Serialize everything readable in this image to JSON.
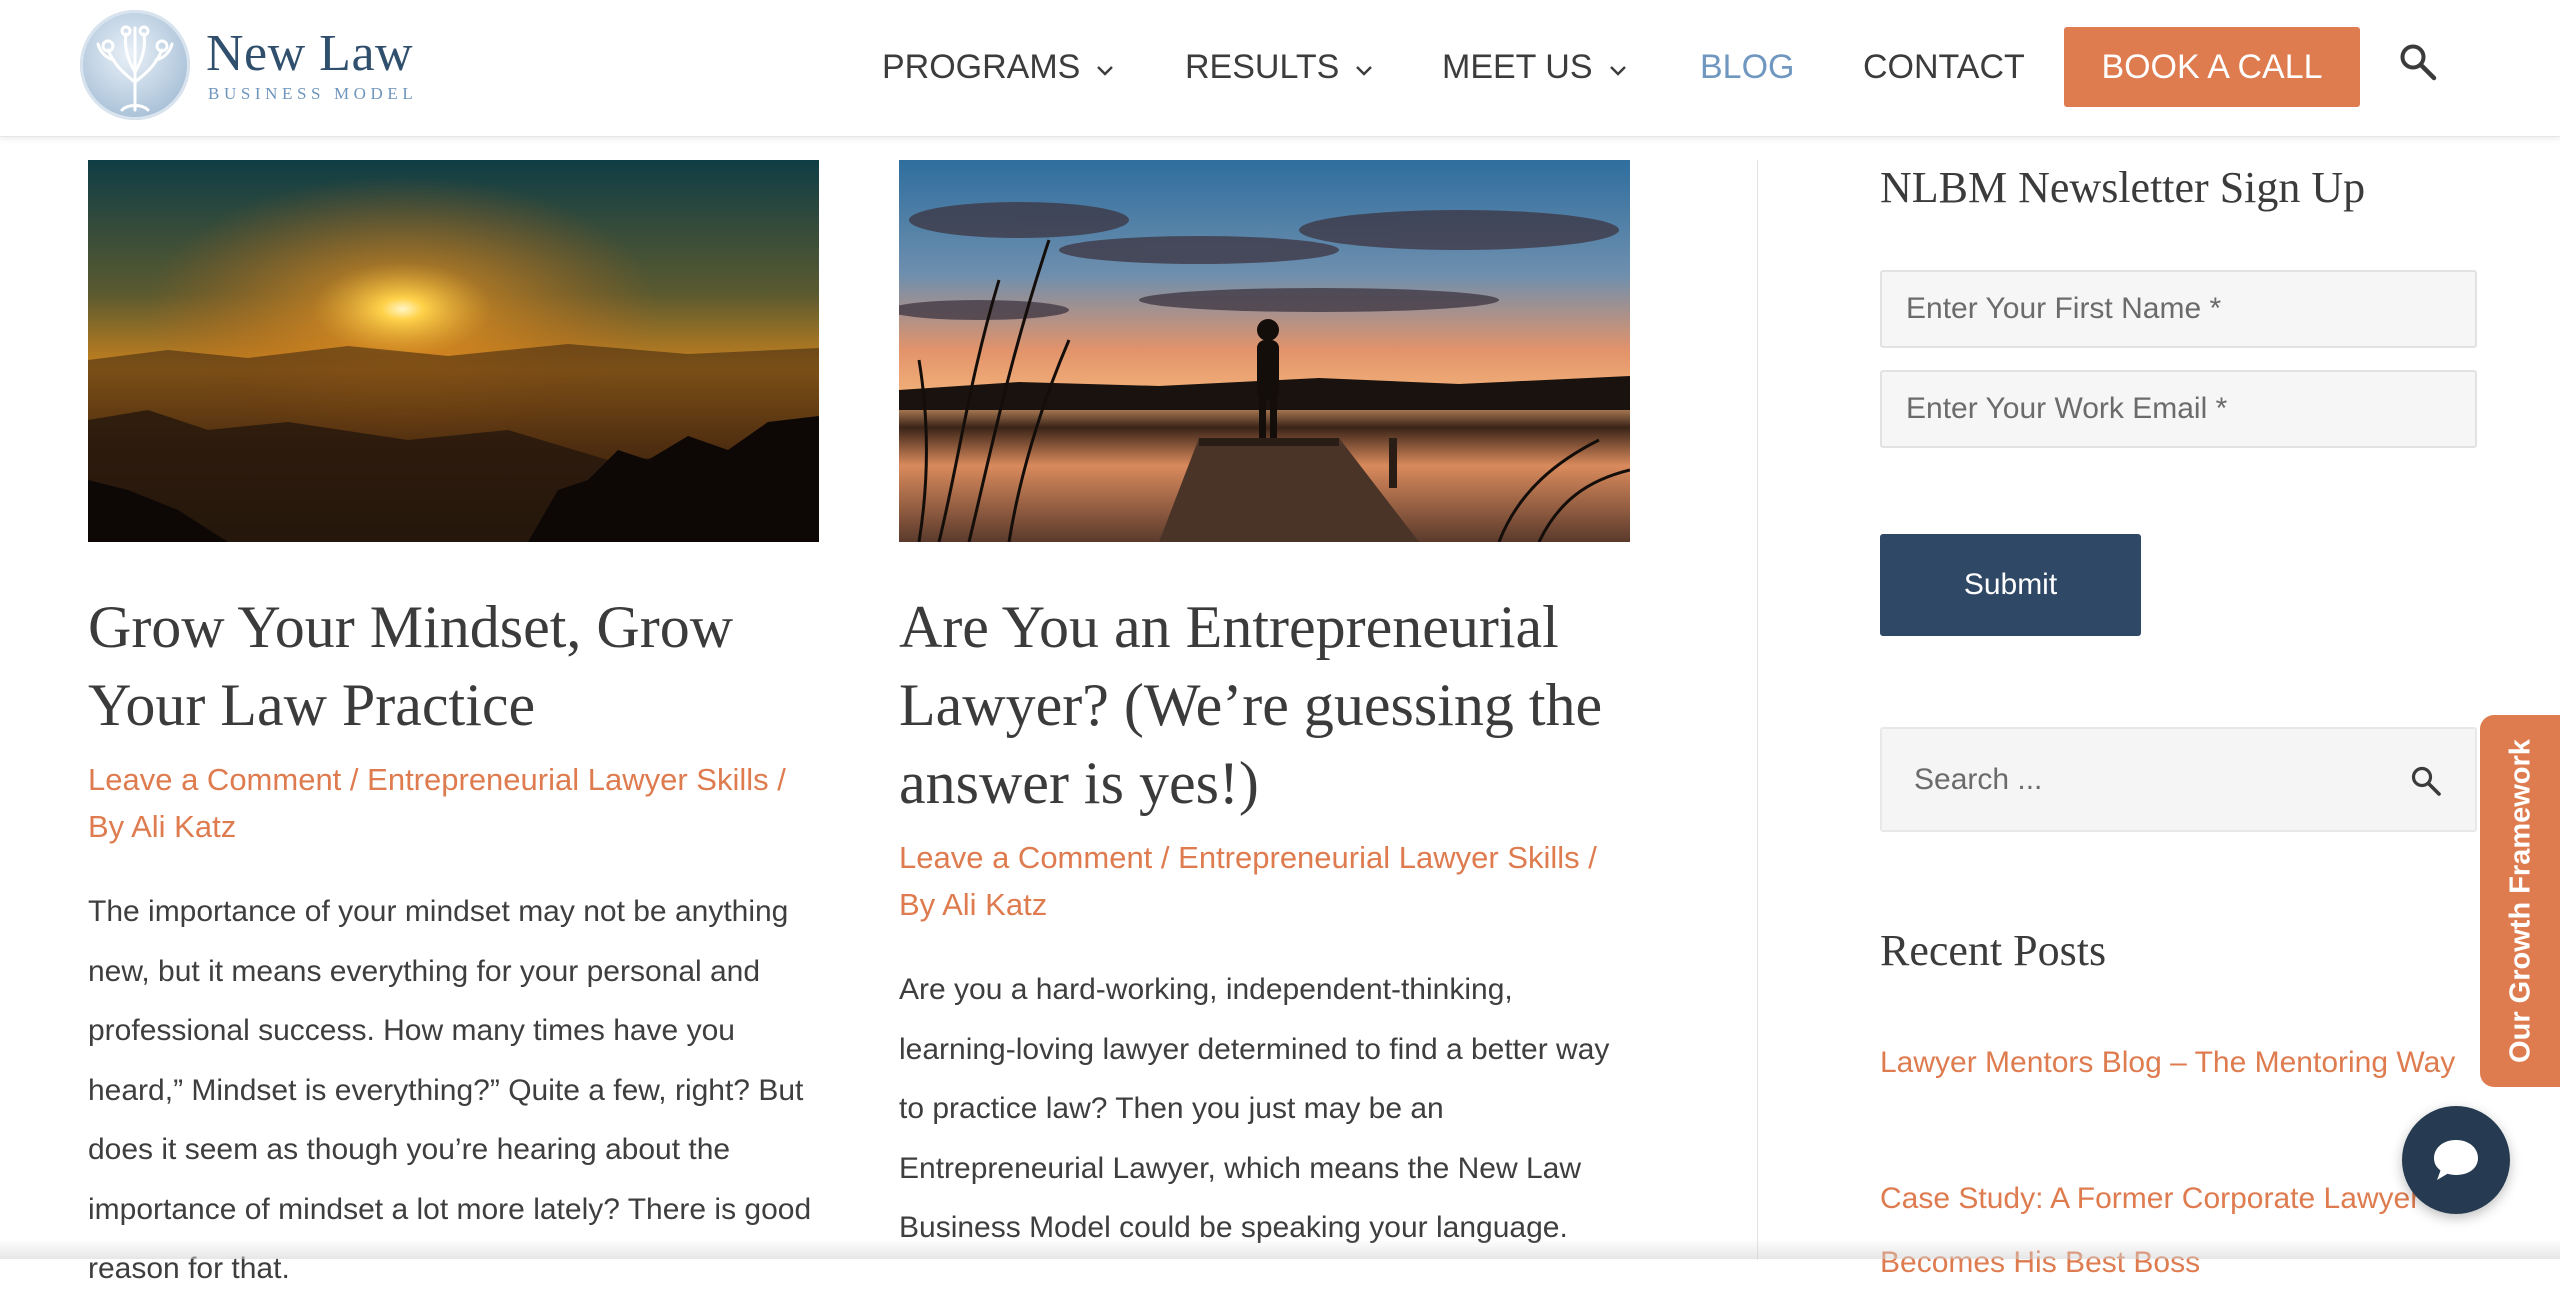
{
  "header": {
    "logo": {
      "name": "New Law",
      "tagline": "BUSINESS MODEL"
    },
    "nav": [
      {
        "label": "PROGRAMS",
        "has_dropdown": true
      },
      {
        "label": "RESULTS",
        "has_dropdown": true
      },
      {
        "label": "MEET US",
        "has_dropdown": true
      },
      {
        "label": "BLOG",
        "has_dropdown": false,
        "active": true
      },
      {
        "label": "CONTACT",
        "has_dropdown": false
      }
    ],
    "cta_label": "BOOK A CALL",
    "search_icon": "search-icon"
  },
  "posts": [
    {
      "title": "Grow Your Mindset, Grow Your Law Practice",
      "meta": {
        "comment": "Leave a Comment",
        "sep1": " / ",
        "category": "Entrepreneurial Lawyer Skills",
        "sep2": " /",
        "by": "By ",
        "author": "Ali Katz"
      },
      "excerpt": "The importance of your mindset may not be anything new, but it means everything for your personal and professional success. How many times have you heard,” Mindset is everything?” Quite a few, right? But does it seem as though you’re hearing about the importance of mindset a lot more lately? There is good reason for that."
    },
    {
      "title": "Are You an Entrepreneurial Lawyer? (We’re guessing the answer is yes!)",
      "meta": {
        "comment": "Leave a Comment",
        "sep1": " / ",
        "category": "Entrepreneurial Lawyer Skills",
        "sep2": " /",
        "by": "By ",
        "author": "Ali Katz"
      },
      "excerpt": "Are you a hard-working, independent-thinking, learning-loving lawyer determined to find a better way to practice law? Then you just may be an Entrepreneurial Lawyer, which means the New Law Business Model could be speaking your language."
    }
  ],
  "sidebar": {
    "newsletter": {
      "title": "NLBM Newsletter Sign Up",
      "first_name_placeholder": "Enter Your First Name *",
      "email_placeholder": "Enter Your Work Email *",
      "submit_label": "Submit"
    },
    "search": {
      "placeholder": "Search ..."
    },
    "recent": {
      "title": "Recent Posts",
      "items": [
        "Lawyer Mentors Blog – The Mentoring Way",
        "Case Study: A Former Corporate Lawyer Becomes His Best Boss"
      ]
    }
  },
  "floating": {
    "growth_tab": "Our Growth Framework",
    "chat_icon": "chat-bubble-icon"
  },
  "colors": {
    "accent": "#de7b4f",
    "navy": "#2f4866",
    "link_blue": "#6f97bf"
  }
}
